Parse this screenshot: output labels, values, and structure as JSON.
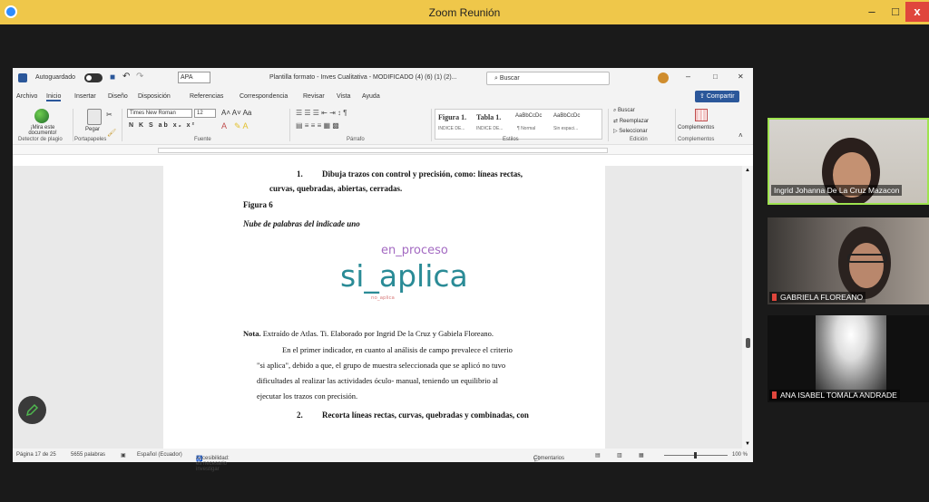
{
  "zoom": {
    "title": "Zoom Reunión",
    "minimize": "–",
    "maximize": "□",
    "close": "x"
  },
  "word": {
    "autosave": "Autoguardado",
    "style_box": "APA",
    "doc_title": "Plantilla formato - Inves Cualitativa - MODIFICADO (4) (6) (1) (2)...",
    "search_placeholder": "Buscar",
    "minimize": "–",
    "maximize": "□",
    "close": "✕",
    "share": "Compartir",
    "menu": [
      "Archivo",
      "Inicio",
      "Insertar",
      "Diseño",
      "Disposición",
      "Referencias",
      "Correspondencia",
      "Revisar",
      "Vista",
      "Ayuda"
    ],
    "ribbon": {
      "detector": "¡Mira este documento!",
      "paste": "Pegar",
      "font_name": "Times New Roman",
      "font_size": "12",
      "styles": [
        {
          "name": "Figura 1.",
          "sub": "INDICE DE..."
        },
        {
          "name": "Tabla 1.",
          "sub": "INDICE DE..."
        },
        {
          "name": "AaBbCcDc",
          "sub": "¶ Normal"
        },
        {
          "name": "AaBbCcDc",
          "sub": "Sin espaci..."
        }
      ],
      "find": "Buscar",
      "replace": "Reemplazar",
      "select": "Seleccionar",
      "addins": "Complementos",
      "groups": {
        "detector": "Detector de plagio",
        "clipboard": "Portapapeles",
        "font": "Fuente",
        "paragraph": "Párrafo",
        "styles": "Estilos",
        "editing": "Edición",
        "addins": "Complementos"
      }
    },
    "document": {
      "item1_num": "1.",
      "item1_line1": "Dibuja trazos con control y precisión, como: líneas rectas,",
      "item1_line2": "curvas, quebradas, abiertas, cerradas.",
      "fig_label": "Figura 6",
      "fig_caption": "Nube de palabras del indicade uno",
      "wordcloud": {
        "top": "en_proceso",
        "main": "si_aplica",
        "small": "no_aplica"
      },
      "note_bold": "Nota.",
      "note_text": "Extraído de Atlas. Ti. Elaborado por Ingrid De la Cruz y Gabiela Floreano.",
      "para": [
        "En el primer indicador, en cuanto al análisis de campo prevalece el criterio",
        "\"si aplica\", debido a que, el grupo de muestra seleccionada que se aplicó no tuvo",
        "dificultades al realizar las actividades óculo- manual, teniendo un equilibrio al",
        "ejecutar los trazos con precisión."
      ],
      "item2_num": "2.",
      "item2_line1": "Recorta líneas rectas, curvas, quebradas y combinadas, con"
    },
    "status": {
      "page": "Página 17 de 25",
      "words": "5655 palabras",
      "language": "Español (Ecuador)",
      "accessibility": "Accesibilidad: es necesario investigar",
      "comments": "Comentarios",
      "zoom": "100 %"
    }
  },
  "participants": [
    {
      "name": "Ingrid Johanna De La Cruz Mazacon",
      "muted": false
    },
    {
      "name": "GABRIELA FLOREANO",
      "muted": true
    },
    {
      "name": "ANA ISABEL TOMALA ANDRADE",
      "muted": true
    }
  ],
  "colors": {
    "zoom_bar": "#efc74a",
    "word_blue": "#2b579a",
    "active_speaker": "#9ee34f"
  }
}
